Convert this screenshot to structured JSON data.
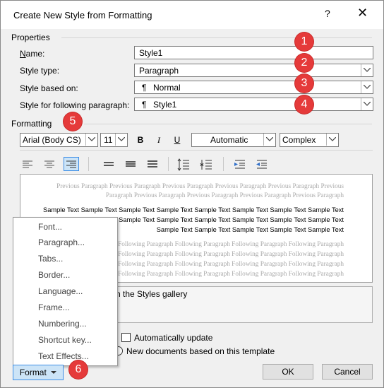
{
  "dialog": {
    "title": "Create New Style from Formatting",
    "help_label": "?",
    "close_label": "✕"
  },
  "properties": {
    "section_label": "Properties",
    "name_label": "Name:",
    "name_value": "Style1",
    "style_type_label": "Style type:",
    "style_type_value": "Paragraph",
    "based_on_label": "Style based on:",
    "based_on_value": "Normal",
    "following_label": "Style for following paragraph:",
    "following_value": "Style1",
    "paragraph_mark": "¶"
  },
  "formatting": {
    "section_label": "Formatting",
    "font_value": "Arial (Body CS)",
    "size_value": "11",
    "bold_label": "B",
    "italic_label": "I",
    "underline_label": "U",
    "color_value": "Automatic",
    "script_value": "Complex"
  },
  "preview": {
    "previous_lines": [
      "Previous Paragraph Previous Paragraph Previous Paragraph Previous Paragraph Previous Paragraph Previous",
      "Paragraph Previous Paragraph Previous Paragraph Previous Paragraph Previous Paragraph"
    ],
    "sample_lines": [
      "Sample Text Sample Text Sample Text Sample Text Sample Text Sample Text Sample Text Sample Text",
      "Sample Text Sample Text Sample Text Sample Text Sample Text Sample Text Sample Text",
      "Sample Text Sample Text Sample Text Sample Text Sample Text"
    ],
    "following_lines": [
      "Following Paragraph Following Paragraph Following Paragraph Following Paragraph",
      "Following Paragraph Following Paragraph Following Paragraph Following Paragraph",
      "Following Paragraph Following Paragraph Following Paragraph Following Paragraph",
      "Following Paragraph Following Paragraph Following Paragraph Following Paragraph"
    ]
  },
  "description_text": "n the Styles gallery",
  "auto_update_label": "Automatically update",
  "new_docs_label": "New documents based on this template",
  "menu": {
    "items": [
      "Font...",
      "Paragraph...",
      "Tabs...",
      "Border...",
      "Language...",
      "Frame...",
      "Numbering...",
      "Shortcut key...",
      "Text Effects..."
    ]
  },
  "buttons": {
    "format_label": "Format",
    "ok_label": "OK",
    "cancel_label": "Cancel"
  },
  "badges": [
    "1",
    "2",
    "3",
    "4",
    "5",
    "6"
  ],
  "colors": {
    "badge": "#e53a3a",
    "selected_align": "#cce4f7",
    "accent_border": "#3d8ee6"
  }
}
